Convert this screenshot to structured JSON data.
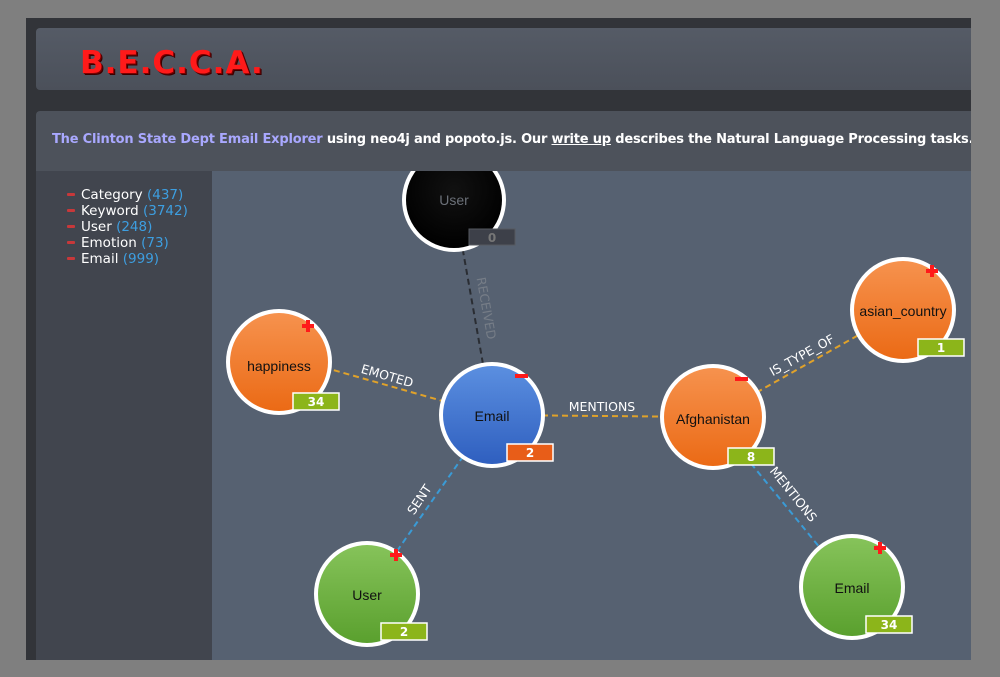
{
  "header": {
    "logo": "B.E.C.C.A."
  },
  "intro": {
    "title_link": "The Clinton State Dept Email Explorer",
    "text_a": " using neo4j and popoto.js. Our ",
    "writeup_link": "write up",
    "text_b": " describes the Natural Language Processing tasks."
  },
  "taxonomy": [
    {
      "label": "Category",
      "count": "(437)"
    },
    {
      "label": "Keyword",
      "count": "(3742)"
    },
    {
      "label": "User",
      "count": "(248)"
    },
    {
      "label": "Emotion",
      "count": "(73)"
    },
    {
      "label": "Email",
      "count": "(999)"
    }
  ],
  "graph": {
    "colors": {
      "email": "#4a78cf",
      "orange": "#f07a2c",
      "green": "#6db03f",
      "black": "#000000",
      "badge_green": "#8cb51a",
      "badge_orange": "#e85d18",
      "badge_dark": "#3d4049",
      "link_orange": "#e0a22a",
      "link_blue": "#3a9bd6",
      "link_dark": "#2a2d33"
    },
    "nodes": {
      "root": {
        "label": "Email",
        "count": "2",
        "kind": "email",
        "mark": "minus"
      },
      "happy": {
        "label": "happiness",
        "count": "34",
        "kind": "orange",
        "mark": "plus"
      },
      "afgh": {
        "label": "Afghanistan",
        "count": "8",
        "kind": "orange",
        "mark": "minus"
      },
      "asian": {
        "label": "asian_country",
        "count": "1",
        "kind": "orange",
        "mark": "plus"
      },
      "sender": {
        "label": "User",
        "count": "2",
        "kind": "green",
        "mark": "plus"
      },
      "email2": {
        "label": "Email",
        "count": "34",
        "kind": "green",
        "mark": "plus"
      },
      "recv": {
        "label": "User",
        "count": "0",
        "kind": "black",
        "mark": "none"
      }
    },
    "links": {
      "emoted": {
        "label": "EMOTED"
      },
      "mentions": {
        "label": "MENTIONS"
      },
      "istype": {
        "label": "IS_TYPE_OF"
      },
      "sent": {
        "label": "SENT"
      },
      "mentions2": {
        "label": "MENTIONS"
      },
      "received": {
        "label": "RECEIVED"
      }
    }
  }
}
